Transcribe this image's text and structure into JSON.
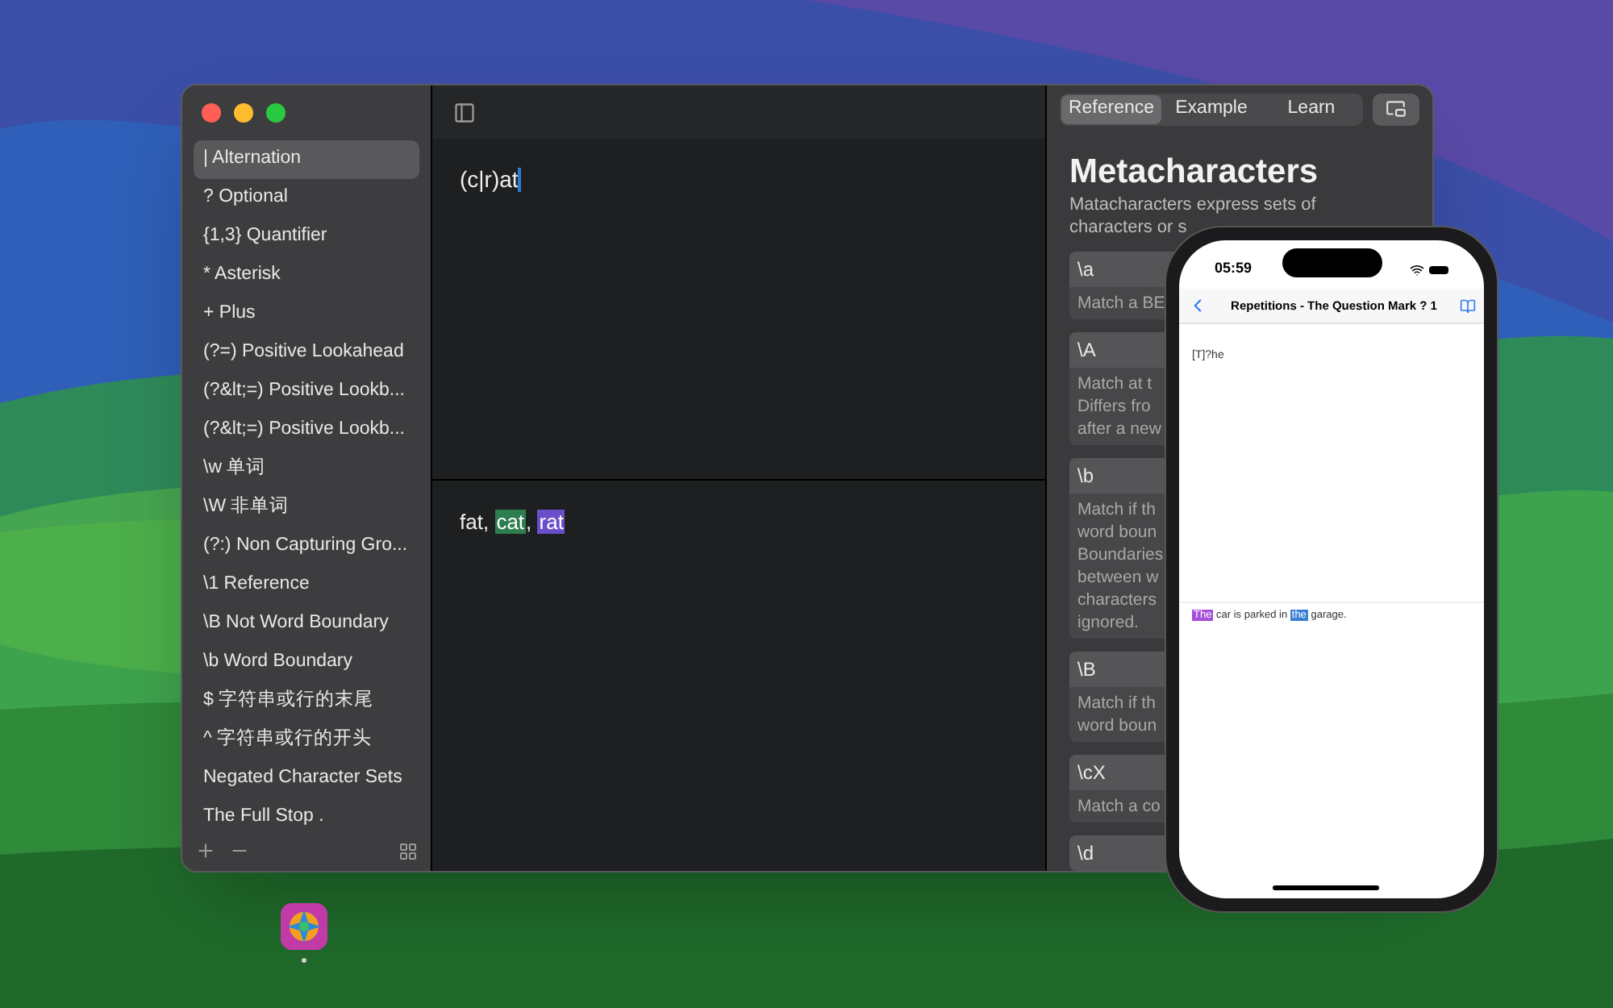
{
  "sidebar": {
    "items": [
      {
        "label": "| Alternation",
        "selected": true
      },
      {
        "label": "? Optional",
        "selected": false
      },
      {
        "label": "{1,3} Quantifier",
        "selected": false
      },
      {
        "label": "* Asterisk",
        "selected": false
      },
      {
        "label": "+ Plus",
        "selected": false
      },
      {
        "label": "(?=) Positive Lookahead",
        "selected": false
      },
      {
        "label": "(?&lt;=) Positive Lookb...",
        "selected": false
      },
      {
        "label": "(?&lt;=) Positive Lookb...",
        "selected": false
      },
      {
        "label": "\\w 单词",
        "selected": false
      },
      {
        "label": "\\W 非单词",
        "selected": false
      },
      {
        "label": "(?:) Non Capturing Gro...",
        "selected": false
      },
      {
        "label": "\\1 Reference",
        "selected": false
      },
      {
        "label": "\\B Not Word Boundary",
        "selected": false
      },
      {
        "label": "\\b Word Boundary",
        "selected": false
      },
      {
        "label": "$ 字符串或行的末尾",
        "selected": false
      },
      {
        "label": "^ 字符串或行的开头",
        "selected": false
      },
      {
        "label": "Negated Character Sets",
        "selected": false
      },
      {
        "label": "The Full Stop .",
        "selected": false
      }
    ]
  },
  "editor": {
    "pattern": "(c|r)at",
    "test_segments": [
      {
        "text": "fat, "
      },
      {
        "text": "cat",
        "color": "#2e7d4f"
      },
      {
        "text": ", "
      },
      {
        "text": "rat",
        "color": "#6a4fc9"
      }
    ]
  },
  "reference_panel": {
    "tabs": [
      {
        "label": "Reference",
        "selected": true
      },
      {
        "label": "Example",
        "selected": false
      },
      {
        "label": "Learn",
        "selected": false
      }
    ],
    "title": "Metacharacters",
    "description_lines": [
      "Matacharacters express sets of",
      "characters or s"
    ],
    "entries": [
      {
        "token": "\\a",
        "lines": [
          "Match a BE"
        ]
      },
      {
        "token": "\\A",
        "lines": [
          "Match at t",
          "Differs fro",
          "after a new"
        ]
      },
      {
        "token": "\\b",
        "lines": [
          "Match if th",
          "word boun",
          "Boundaries",
          "between w",
          "characters",
          "ignored."
        ]
      },
      {
        "token": "\\B",
        "lines": [
          "Match if th",
          "word boun"
        ]
      },
      {
        "token": "\\cX",
        "lines": [
          "Match a co"
        ]
      },
      {
        "token": "\\d"
      }
    ]
  },
  "phone": {
    "time": "05:59",
    "title": "Repetitions - The Question Mark ? 1",
    "pattern": "[T]?he",
    "test_segments": [
      {
        "text": "The",
        "color": "#a64fd8"
      },
      {
        "text": " car is parked in "
      },
      {
        "text": "the",
        "color": "#3b7fd4"
      },
      {
        "text": " garage."
      }
    ]
  }
}
